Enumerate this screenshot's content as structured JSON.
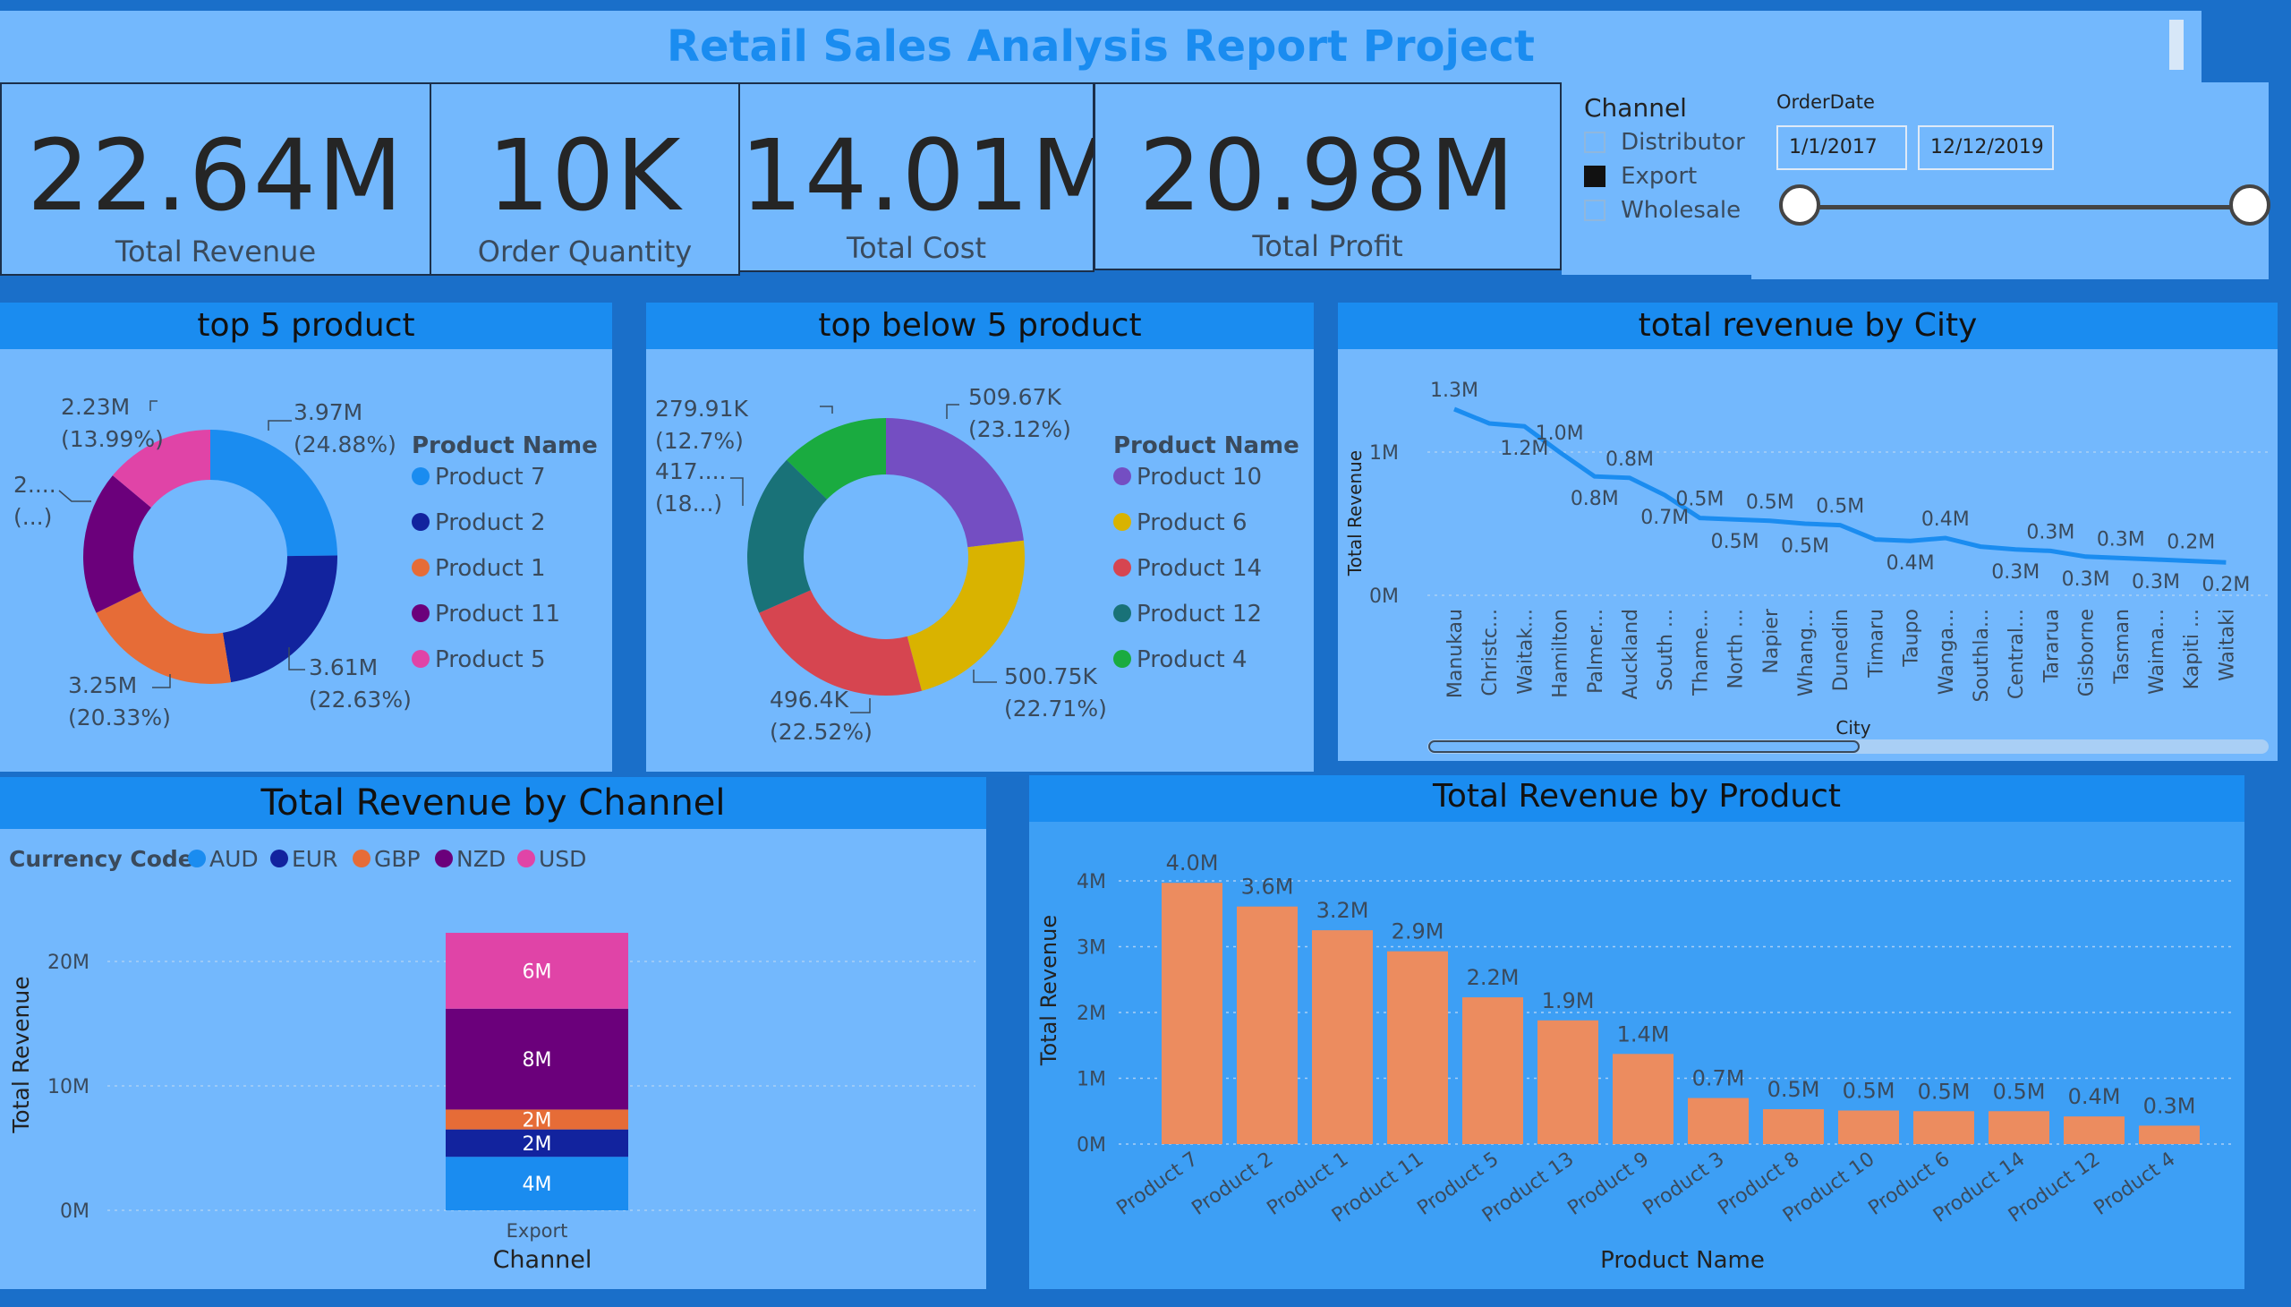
{
  "report": {
    "title": "Retail Sales Analysis Report  Project"
  },
  "kpis": [
    {
      "value": "22.64M",
      "label": "Total Revenue"
    },
    {
      "value": "10K",
      "label": "Order Quantity"
    },
    {
      "value": "14.01M",
      "label": "Total Cost"
    },
    {
      "value": "20.98M",
      "label": "Total Profit"
    }
  ],
  "channel_slicer": {
    "title": "Channel",
    "options": [
      {
        "label": "Distributor",
        "checked": false
      },
      {
        "label": "Export",
        "checked": true
      },
      {
        "label": "Wholesale",
        "checked": false
      }
    ]
  },
  "date_slicer": {
    "title": "OrderDate",
    "start": "1/1/2017",
    "end": "12/12/2019"
  },
  "colors": {
    "background": "#1a6fc9",
    "panel": "#73b8fd",
    "title_band": "#1a8cf0",
    "title_text": "#1a8cf0",
    "bar": "#ec8c5f",
    "line": "#1a8cf0"
  },
  "chart_data": [
    {
      "type": "pie",
      "title": "top 5 product",
      "legend_title": "Product Name",
      "slices": [
        {
          "name": "Product 7",
          "value": 3.97,
          "label": "3.97M",
          "pct": "(24.88%)",
          "color": "#1a8cf0"
        },
        {
          "name": "Product 2",
          "value": 3.61,
          "label": "3.61M",
          "pct": "(22.63%)",
          "color": "#12239e"
        },
        {
          "name": "Product 1",
          "value": 3.25,
          "label": "3.25M",
          "pct": "(20.33%)",
          "color": "#e66c37"
        },
        {
          "name": "Product 11",
          "value": 2.93,
          "label": "2....",
          "pct": "(...)",
          "color": "#6b007b"
        },
        {
          "name": "Product 5",
          "value": 2.23,
          "label": "2.23M",
          "pct": "(13.99%)",
          "color": "#e044a7"
        }
      ]
    },
    {
      "type": "pie",
      "title": "top below 5 product",
      "legend_title": "Product Name",
      "slices": [
        {
          "name": "Product 10",
          "value": 509.67,
          "label": "509.67K",
          "pct": "(23.12%)",
          "color": "#744ec2"
        },
        {
          "name": "Product 6",
          "value": 500.75,
          "label": "500.75K",
          "pct": "(22.71%)",
          "color": "#d9b300"
        },
        {
          "name": "Product 14",
          "value": 496.4,
          "label": "496.4K",
          "pct": "(22.52%)",
          "color": "#d64550"
        },
        {
          "name": "Product 12",
          "value": 417,
          "label": "417....",
          "pct": "(18...)",
          "color": "#197278"
        },
        {
          "name": "Product 4",
          "value": 279.91,
          "label": "279.91K",
          "pct": "(12.7%)",
          "color": "#1aab40"
        }
      ]
    },
    {
      "type": "line",
      "title": "total revenue by City",
      "xlabel": "City",
      "ylabel": "Total Revenue",
      "yticks": [
        "0M",
        "1M"
      ],
      "ylim": [
        0,
        1.4
      ],
      "categories": [
        "Manukau",
        "Christc...",
        "Waitak...",
        "Hamilton",
        "Palmer...",
        "Auckland",
        "South ...",
        "Thame...",
        "North ...",
        "Napier",
        "Whang...",
        "Dunedin",
        "Timaru",
        "Taupo",
        "Wanga...",
        "Southla...",
        "Central...",
        "Tararua",
        "Gisborne",
        "Tasman",
        "Waima...",
        "Kapiti ...",
        "Waitaki"
      ],
      "values": [
        1.3,
        1.2,
        1.18,
        1.0,
        0.83,
        0.82,
        0.7,
        0.54,
        0.53,
        0.52,
        0.5,
        0.49,
        0.39,
        0.38,
        0.4,
        0.34,
        0.32,
        0.31,
        0.27,
        0.26,
        0.25,
        0.24,
        0.23
      ],
      "data_labels": [
        "1.3M",
        "1.2M",
        "1.0M",
        "0.8M",
        "0.8M",
        "0.7M",
        "0.5M",
        "0.5M",
        "0.5M",
        "0.5M",
        "0.5M",
        "0.4M",
        "0.4M",
        "0.3M",
        "0.3M",
        "0.3M",
        "0.3M",
        "0.3M",
        "0.2M",
        "0.2M"
      ],
      "label_positions": [
        0,
        2,
        3,
        4,
        5,
        6,
        7,
        8,
        9,
        10,
        11,
        13,
        14,
        16,
        17,
        18,
        19,
        20,
        21,
        22
      ]
    },
    {
      "type": "bar",
      "title": "Total Revenue by Channel",
      "legend_title": "Currency Code",
      "xlabel": "Channel",
      "ylabel": "Total Revenue",
      "yticks": [
        "0M",
        "10M",
        "20M"
      ],
      "ylim": [
        0,
        22.64
      ],
      "categories": [
        "Export"
      ],
      "series": [
        {
          "name": "AUD",
          "values": [
            4.3
          ],
          "label": "4M",
          "color": "#1a8cf0"
        },
        {
          "name": "EUR",
          "values": [
            2.2
          ],
          "label": "2M",
          "color": "#12239e"
        },
        {
          "name": "GBP",
          "values": [
            1.6
          ],
          "label": "2M",
          "color": "#e66c37"
        },
        {
          "name": "NZD",
          "values": [
            8.1
          ],
          "label": "8M",
          "color": "#6b007b"
        },
        {
          "name": "USD",
          "values": [
            6.1
          ],
          "label": "6M",
          "color": "#e044a7"
        }
      ]
    },
    {
      "type": "bar",
      "title": "Total Revenue by Product",
      "xlabel": "Product Name",
      "ylabel": "Total Revenue",
      "yticks": [
        "0M",
        "1M",
        "2M",
        "3M",
        "4M"
      ],
      "ylim": [
        0,
        4.3
      ],
      "categories": [
        "Product 7",
        "Product 2",
        "Product 1",
        "Product 11",
        "Product 5",
        "Product 13",
        "Product 9",
        "Product 3",
        "Product 8",
        "Product 10",
        "Product 6",
        "Product 14",
        "Product 12",
        "Product 4"
      ],
      "values": [
        3.97,
        3.61,
        3.25,
        2.93,
        2.23,
        1.88,
        1.37,
        0.7,
        0.53,
        0.51,
        0.5,
        0.5,
        0.42,
        0.28
      ],
      "data_labels": [
        "4.0M",
        "3.6M",
        "3.2M",
        "2.9M",
        "2.2M",
        "1.9M",
        "1.4M",
        "0.7M",
        "0.5M",
        "0.5M",
        "0.5M",
        "0.5M",
        "0.4M",
        "0.3M"
      ]
    }
  ]
}
